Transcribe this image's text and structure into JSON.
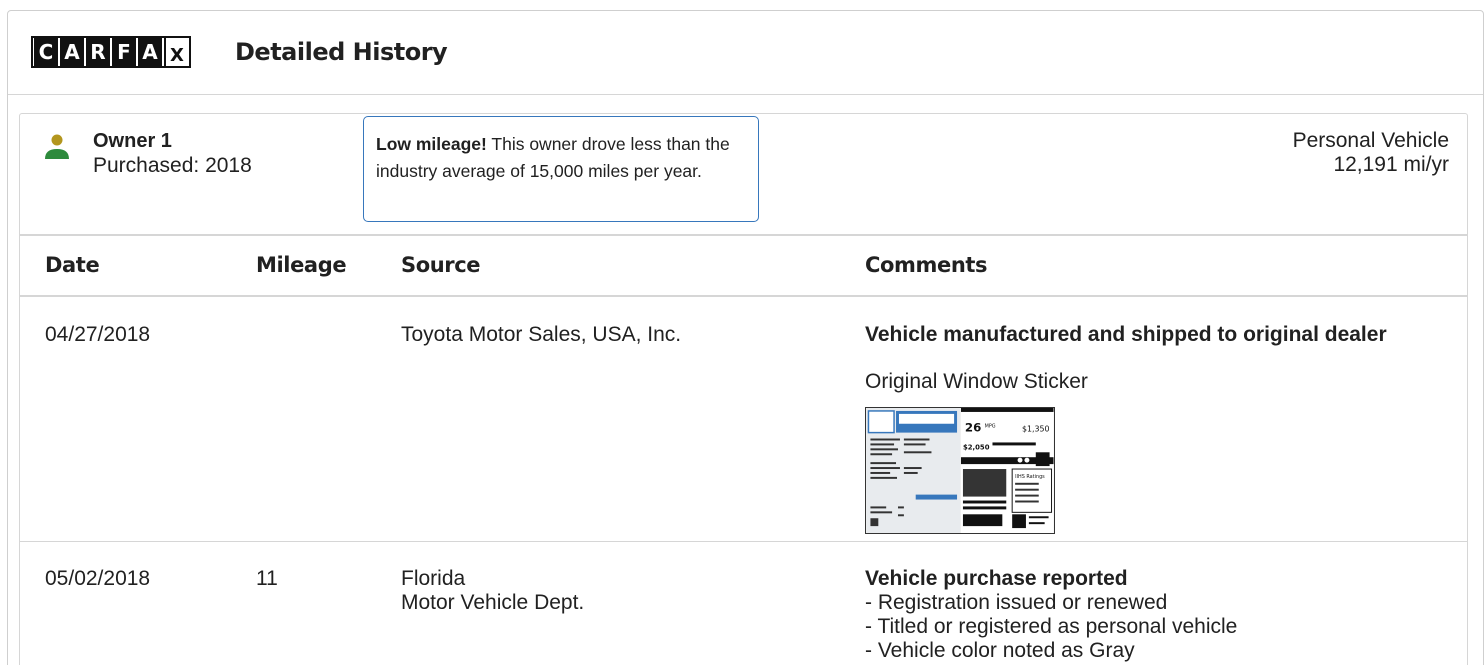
{
  "header": {
    "logo_letters": [
      "C",
      "A",
      "R",
      "F",
      "A",
      "X"
    ],
    "title": "Detailed History"
  },
  "owner": {
    "name": "Owner 1",
    "purchased": "Purchased: 2018",
    "callout_bold": "Low mileage!",
    "callout_text": " This owner drove less than the industry average of 15,000 miles per year.",
    "usage_type": "Personal Vehicle",
    "miles_per_year": "12,191 mi/yr",
    "icon_color": "#b3961e",
    "icon_body_color": "#2d8a3c",
    "accent": "#3777bc"
  },
  "table": {
    "columns": [
      "Date",
      "Mileage",
      "Source",
      "Comments"
    ],
    "rows": [
      {
        "date": "04/27/2018",
        "mileage": "",
        "source_lines": [
          "Toyota Motor Sales, USA, Inc."
        ],
        "comment_title": "Vehicle manufactured and shipped to original dealer",
        "comment_sub": "Original Window Sticker",
        "sticker": {
          "mpg": "26",
          "mpg_unit": "MPG",
          "fuel_cost": "$2,050",
          "annual_cost": "$1,350",
          "label": "IIHS Ratings"
        }
      },
      {
        "date": "05/02/2018",
        "mileage": "11",
        "source_lines": [
          "Florida",
          "Motor Vehicle Dept."
        ],
        "comment_title": "Vehicle purchase reported",
        "comment_items": [
          "- Registration issued or renewed",
          "- Titled or registered as personal vehicle",
          "- Vehicle color noted as Gray"
        ]
      }
    ]
  }
}
